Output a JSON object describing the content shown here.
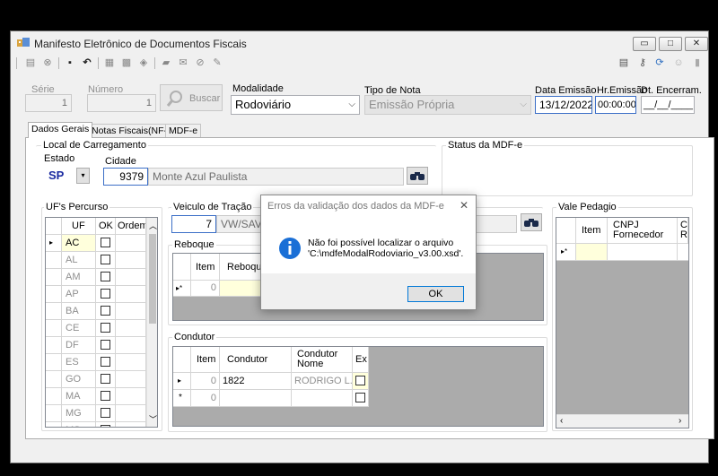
{
  "window": {
    "title": "Manifesto Eletrônico de Documentos Fiscais",
    "min_label": "▭",
    "max_label": "□",
    "close_label": "✕"
  },
  "toolbar": {
    "icons": [
      "new-doc-icon",
      "cancel-icon",
      "save-icon",
      "undo-icon",
      "print-preview-icon",
      "export-icon",
      "erase-icon",
      "car-icon",
      "email-icon",
      "block-icon",
      "edit-icon"
    ],
    "right_icons": [
      "report-icon",
      "key-icon",
      "refresh-icon",
      "user-icon",
      "exit-icon"
    ]
  },
  "header": {
    "serie_label": "Série",
    "serie_value": "1",
    "numero_label": "Número",
    "numero_value": "1",
    "buscar_label": "Buscar",
    "modalidade_label": "Modalidade",
    "modalidade_value": "Rodoviário",
    "tipo_nota_label": "Tipo de Nota",
    "tipo_nota_value": "Emissão Própria",
    "data_emissao_label": "Data Emissão",
    "data_emissao_value": "13/12/2022",
    "hr_emissao_label": "Hr.Emissão",
    "hr_emissao_value": "00:00:00",
    "dt_encerr_label": "Dt. Encerram.",
    "dt_encerr_value": "__/__/____"
  },
  "tabs": [
    {
      "label": "Dados Gerais",
      "active": true
    },
    {
      "label": "Notas Fiscais(NF-e)",
      "active": false
    },
    {
      "label": "MDF-e",
      "active": false
    }
  ],
  "carregamento": {
    "title": "Local de Carregamento",
    "estado_label": "Estado",
    "estado_value": "SP",
    "cidade_label": "Cidade",
    "cidade_code": "9379",
    "cidade_name": "Monte Azul Paulista"
  },
  "status": {
    "title": "Status da MDF-e"
  },
  "ufs": {
    "title": "UF's Percurso",
    "headers": [
      "UF",
      "OK",
      "Ordem"
    ],
    "rows": [
      "AC",
      "AL",
      "AM",
      "AP",
      "BA",
      "CE",
      "DF",
      "ES",
      "GO",
      "MA",
      "MG",
      "MS"
    ]
  },
  "veiculo": {
    "title": "Veiculo de Tração",
    "code": "7",
    "name": "VW/SAV"
  },
  "reboque": {
    "title": "Reboque",
    "headers": [
      "Item",
      "Reboque"
    ],
    "new_row_item": "0"
  },
  "condutor": {
    "title": "Condutor",
    "headers": [
      "Item",
      "Condutor",
      "Condutor Nome",
      "Ex"
    ],
    "rows": [
      {
        "item": "0",
        "condutor": "1822",
        "nome": "RODRIGO L..."
      },
      {
        "item": "0",
        "condutor": "",
        "nome": ""
      }
    ]
  },
  "vale": {
    "title": "Vale Pedagio",
    "headers": [
      "Item",
      "CNPJ Fornecedor",
      "C R"
    ]
  },
  "dialog": {
    "title": "Erros da validação dos dados da MDF-e",
    "close_label": "✕",
    "message_line1": "Não foi possível localizar o arquivo",
    "message_line2": "'C:\\mdfeModalRodoviario_v3.00.xsd'.",
    "ok_label": "OK"
  }
}
